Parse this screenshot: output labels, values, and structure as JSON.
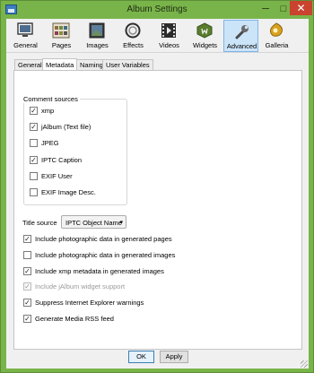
{
  "window": {
    "title": "Album Settings",
    "minimize_glyph": "─",
    "maximize_glyph": "□",
    "close_glyph": "✕"
  },
  "toolbar": {
    "items": [
      {
        "label": "General",
        "icon": "monitor-icon",
        "active": false
      },
      {
        "label": "Pages",
        "icon": "pages-grid-icon",
        "active": false
      },
      {
        "label": "Images",
        "icon": "image-icon",
        "active": false
      },
      {
        "label": "Effects",
        "icon": "effects-ring-icon",
        "active": false
      },
      {
        "label": "Videos",
        "icon": "film-icon",
        "active": false
      },
      {
        "label": "Widgets",
        "icon": "widget-box-icon",
        "active": false
      },
      {
        "label": "Advanced",
        "icon": "wrench-icon",
        "active": true
      },
      {
        "label": "Galleria",
        "icon": "galleria-icon",
        "active": false
      }
    ]
  },
  "tabs": [
    {
      "label": "General",
      "active": false
    },
    {
      "label": "Metadata",
      "active": true
    },
    {
      "label": "Naming",
      "active": false
    },
    {
      "label": "User Variables",
      "active": false
    }
  ],
  "comment_sources": {
    "title": "Comment sources",
    "items": [
      {
        "label": "xmp",
        "checked": true
      },
      {
        "label": "jAlbum (Text file)",
        "checked": true
      },
      {
        "label": "JPEG",
        "checked": false
      },
      {
        "label": "IPTC Caption",
        "checked": true
      },
      {
        "label": "EXIF User",
        "checked": false
      },
      {
        "label": "EXIF Image Desc.",
        "checked": false
      }
    ]
  },
  "title_source": {
    "label": "Title source",
    "value": "IPTC Object Name",
    "arrow": "▾"
  },
  "options": [
    {
      "label": "Include photographic data in generated pages",
      "checked": true,
      "disabled": false
    },
    {
      "label": "Include photographic data in generated images",
      "checked": false,
      "disabled": false
    },
    {
      "label": "Include xmp metadata in generated images",
      "checked": true,
      "disabled": false
    },
    {
      "label": "Include jAlbum widget support",
      "checked": true,
      "disabled": true
    },
    {
      "label": "Suppress Internet Explorer warnings",
      "checked": true,
      "disabled": false
    },
    {
      "label": "Generate Media RSS feed",
      "checked": true,
      "disabled": false
    }
  ],
  "check_glyph": "✓",
  "buttons": {
    "ok": "OK",
    "apply": "Apply"
  },
  "colors": {
    "frame": "#79b44a",
    "selected_tool": "#cce4f7",
    "close_button": "#c9432e"
  }
}
